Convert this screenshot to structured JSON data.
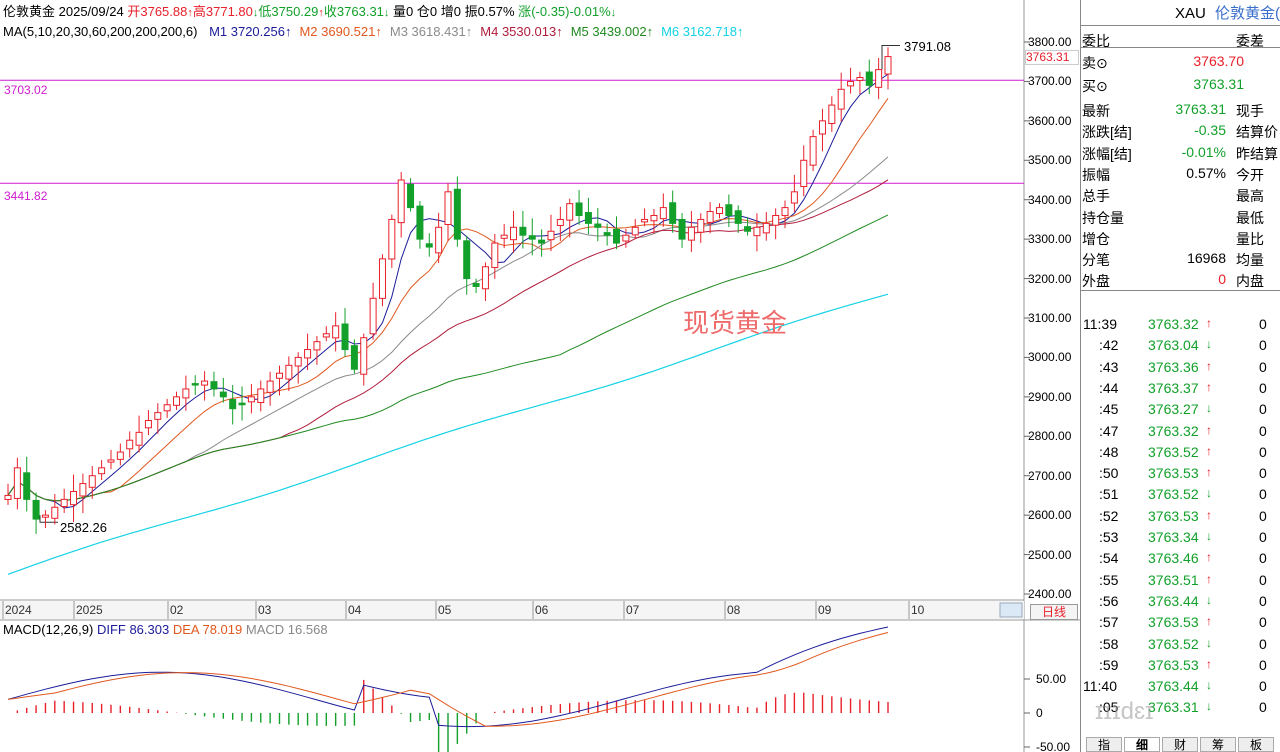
{
  "header": {
    "symbol": "伦敦黄金",
    "date": "2025/09/24",
    "open_label": "开",
    "open": "3765.88",
    "high_label": "高",
    "high": "3771.80",
    "low_label": "低",
    "low": "3750.29",
    "close_label": "收",
    "close": "3763.31",
    "volume_label": "量",
    "volume": "0",
    "oi_label": "仓",
    "oi": "0",
    "incr_label": "增",
    "incr": "0",
    "amp_label": "振",
    "amp": "0.57%",
    "change_label": "涨",
    "change": "(-0.35)-0.01%"
  },
  "ma_legend": {
    "label": "MA(5,10,20,30,60,200,200,200,6)",
    "items": [
      {
        "name": "M1",
        "value": "3720.256",
        "arrow": "↑",
        "color": "#1c1c9a"
      },
      {
        "name": "M2",
        "value": "3690.521",
        "arrow": "↑",
        "color": "#e0581e"
      },
      {
        "name": "M3",
        "value": "3618.431",
        "arrow": "↑",
        "color": "#8a8a8a"
      },
      {
        "name": "M4",
        "value": "3530.013",
        "arrow": "↑",
        "color": "#b01c3c"
      },
      {
        "name": "M5",
        "value": "3439.002",
        "arrow": "↑",
        "color": "#1f8a1f"
      },
      {
        "name": "M6",
        "value": "3162.718",
        "arrow": "↑",
        "color": "#15d2e6"
      }
    ]
  },
  "hlines": [
    {
      "value": 3703.02,
      "label": "3703.02"
    },
    {
      "value": 3441.82,
      "label": "3441.82"
    }
  ],
  "annotations": {
    "peak": "3791.08",
    "trough": "2582.26",
    "watermark": "现货黄金",
    "price_tag": "3763.31"
  },
  "chart_data": {
    "type": "candlestick",
    "x_labels": [
      "2024",
      "2025",
      "02",
      "03",
      "04",
      "05",
      "06",
      "07",
      "08",
      "09",
      "10"
    ],
    "y_ticks": [
      "3800.00",
      "3700.00",
      "3600.00",
      "3500.00",
      "3400.00",
      "3300.00",
      "3200.00",
      "3100.00",
      "3000.00",
      "2900.00",
      "2800.00",
      "2700.00",
      "2600.00",
      "2500.00",
      "2400.00"
    ],
    "ylim": [
      2400,
      3800
    ],
    "period_label": "日线",
    "close_path": [
      2650,
      2720,
      2640,
      2590,
      2600,
      2620,
      2640,
      2660,
      2680,
      2700,
      2720,
      2740,
      2760,
      2790,
      2810,
      2840,
      2860,
      2880,
      2900,
      2920,
      2930,
      2940,
      2920,
      2900,
      2870,
      2880,
      2900,
      2920,
      2940,
      2960,
      2980,
      3000,
      3020,
      3040,
      3060,
      3080,
      3020,
      2970,
      3050,
      3150,
      3250,
      3350,
      3450,
      3380,
      3300,
      3280,
      3330,
      3420,
      3300,
      3200,
      3180,
      3230,
      3290,
      3310,
      3330,
      3310,
      3300,
      3290,
      3320,
      3350,
      3390,
      3360,
      3340,
      3330,
      3310,
      3290,
      3310,
      3330,
      3350,
      3360,
      3380,
      3340,
      3300,
      3330,
      3350,
      3370,
      3380,
      3360,
      3340,
      3320,
      3330,
      3340,
      3360,
      3380,
      3420,
      3500,
      3560,
      3600,
      3640,
      3680,
      3700,
      3710,
      3690,
      3730,
      3763
    ],
    "macd": {
      "label": "MACD(12,26,9)",
      "diff_label": "DIFF",
      "diff": "86.303",
      "dea_label": "DEA",
      "dea": "78.019",
      "macd_label": "MACD",
      "macd_value": "16.568",
      "y_ticks": [
        "50.00",
        "0",
        "-50.00"
      ]
    }
  },
  "quote": {
    "symbol": "XAU",
    "name": "伦敦黄金(",
    "rows": [
      {
        "label": "委比",
        "value": "",
        "label2": "委差"
      },
      {
        "label": "卖",
        "icon": "⊙",
        "value": "3763.70",
        "color": "#e8202a"
      },
      {
        "label": "买",
        "icon": "⊙",
        "value": "3763.31",
        "color": "#12a02a"
      },
      {
        "label": "最新",
        "value": "3763.31",
        "color": "#12a02a",
        "label2": "现手"
      },
      {
        "label": "涨跌[结]",
        "value": "-0.35",
        "color": "#12a02a",
        "label2": "结算价"
      },
      {
        "label": "涨幅[结]",
        "value": "-0.01%",
        "color": "#12a02a",
        "label2": "昨结算"
      },
      {
        "label": "振幅",
        "value": "0.57%",
        "color": "#000000",
        "label2": "今开"
      },
      {
        "label": "总手",
        "value": "",
        "label2": "最高"
      },
      {
        "label": "持仓量",
        "value": "",
        "label2": "最低"
      },
      {
        "label": "增仓",
        "value": "",
        "label2": "量比"
      },
      {
        "label": "分笔",
        "value": "16968",
        "color": "#000000",
        "label2": "均量"
      },
      {
        "label": "外盘",
        "value": "0",
        "color": "#e8202a",
        "label2": "内盘"
      }
    ]
  },
  "ticks": [
    {
      "time": "11:39",
      "price": "3763.32",
      "dir": "↑",
      "vol": "0"
    },
    {
      "time": ":42",
      "price": "3763.04",
      "dir": "↓",
      "vol": "0"
    },
    {
      "time": ":43",
      "price": "3763.36",
      "dir": "↑",
      "vol": "0"
    },
    {
      "time": ":44",
      "price": "3763.37",
      "dir": "↑",
      "vol": "0"
    },
    {
      "time": ":45",
      "price": "3763.27",
      "dir": "↓",
      "vol": "0"
    },
    {
      "time": ":47",
      "price": "3763.32",
      "dir": "↑",
      "vol": "0"
    },
    {
      "time": ":48",
      "price": "3763.52",
      "dir": "↑",
      "vol": "0"
    },
    {
      "time": ":50",
      "price": "3763.53",
      "dir": "↑",
      "vol": "0"
    },
    {
      "time": ":51",
      "price": "3763.52",
      "dir": "↓",
      "vol": "0"
    },
    {
      "time": ":52",
      "price": "3763.53",
      "dir": "↑",
      "vol": "0"
    },
    {
      "time": ":53",
      "price": "3763.34",
      "dir": "↓",
      "vol": "0"
    },
    {
      "time": ":54",
      "price": "3763.46",
      "dir": "↑",
      "vol": "0"
    },
    {
      "time": ":55",
      "price": "3763.51",
      "dir": "↑",
      "vol": "0"
    },
    {
      "time": ":56",
      "price": "3763.44",
      "dir": "↓",
      "vol": "0"
    },
    {
      "time": ":57",
      "price": "3763.53",
      "dir": "↑",
      "vol": "0"
    },
    {
      "time": ":58",
      "price": "3763.52",
      "dir": "↓",
      "vol": "0"
    },
    {
      "time": ":59",
      "price": "3763.53",
      "dir": "↑",
      "vol": "0"
    },
    {
      "time": "11:40",
      "price": "3763.44",
      "dir": "↓",
      "vol": "0"
    },
    {
      "time": ":05",
      "price": "3763.31",
      "dir": "↓",
      "vol": "0"
    }
  ],
  "bottom_tabs": [
    "指",
    "细",
    "财",
    "筹",
    "板"
  ],
  "watermark_brand": "ɪɪɪdɛɪ"
}
